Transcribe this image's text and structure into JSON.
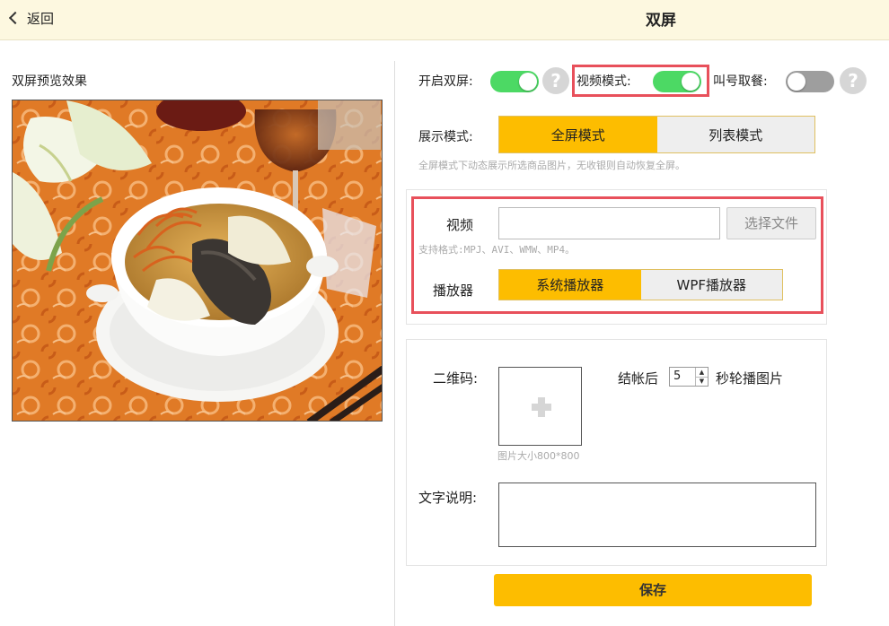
{
  "header": {
    "back_label": "返回",
    "title": "双屏"
  },
  "preview": {
    "title": "双屏预览效果",
    "image_alt": "food photo: soup bowl with sea cucumber and cordyceps"
  },
  "toggles": {
    "dual_screen": {
      "label": "开启双屏:",
      "on": true
    },
    "video_mode": {
      "label": "视频模式:",
      "on": true
    },
    "call_number": {
      "label": "叫号取餐:",
      "on": false
    },
    "help_glyph": "?"
  },
  "display_mode": {
    "label": "展示模式:",
    "options": [
      "全屏模式",
      "列表模式"
    ],
    "selected": "全屏模式",
    "hint": "全屏模式下动态展示所选商品图片，无收银则自动恢复全屏。"
  },
  "video": {
    "label": "视频",
    "value": "",
    "choose_file": "选择文件",
    "formats_hint": "支持格式:MPJ、AVI、WMW、MP4。",
    "player_label": "播放器",
    "player_options": [
      "系统播放器",
      "WPF播放器"
    ],
    "player_selected": "系统播放器"
  },
  "qr": {
    "label": "二维码:",
    "size_hint": "图片大小800*800",
    "after_checkout_label": "结帐后",
    "seconds": "5",
    "seconds_suffix": "秒轮播图片"
  },
  "text_desc": {
    "label": "文字说明:",
    "value": ""
  },
  "save_label": "保存",
  "colors": {
    "accent": "#fdbd00",
    "toggle_on": "#4cd964",
    "highlight": "#e8505b",
    "header_bg": "#fdf8e0"
  }
}
